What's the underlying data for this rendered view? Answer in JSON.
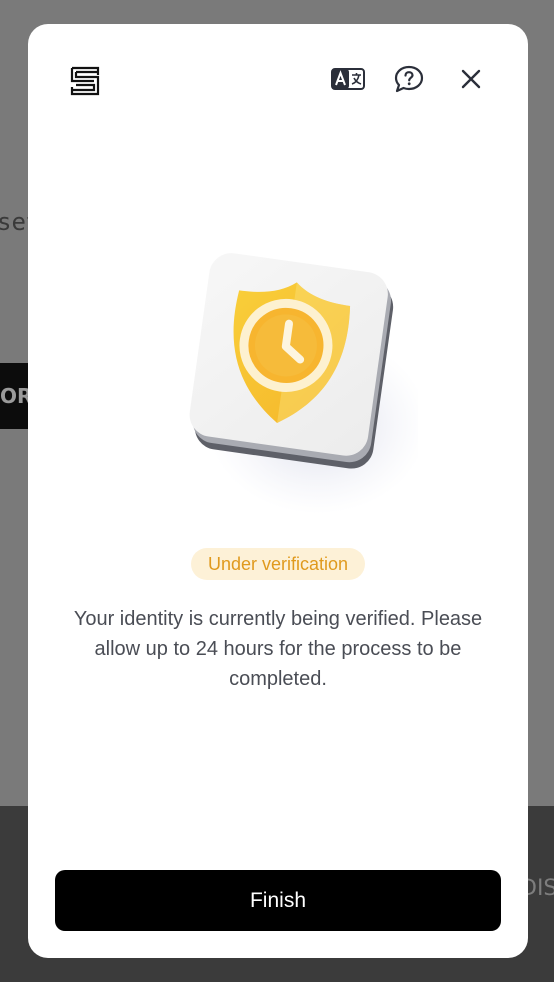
{
  "background": {
    "left_text": "set",
    "button_text": "ORA",
    "right_text": "DIS"
  },
  "modal": {
    "logo_icon": "brand-logo-icon",
    "header_icons": [
      "translate-icon",
      "help-chat-icon",
      "close-icon"
    ],
    "illustration_icon": "shield-clock-icon",
    "status_badge": "Under verification",
    "message": "Your identity is currently being verified. Please allow up to 24 hours for the process to be completed.",
    "finish_label": "Finish"
  },
  "colors": {
    "badge_bg": "#fdf1d7",
    "badge_text": "#e09a1e",
    "shield": "#f7c530",
    "button_bg": "#000000"
  }
}
